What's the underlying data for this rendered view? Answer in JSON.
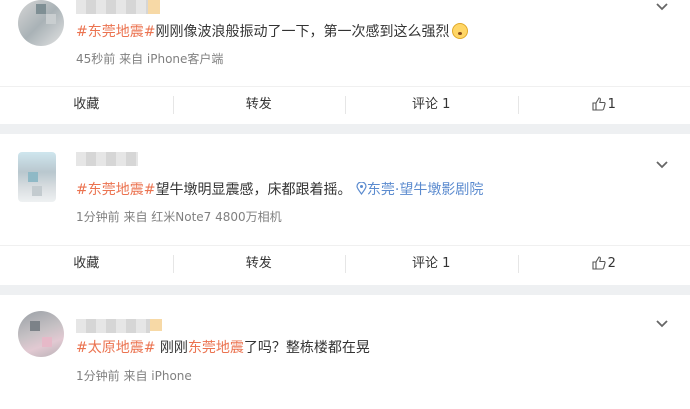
{
  "posts": [
    {
      "text_parts": [
        "#",
        "东莞地震",
        "#",
        "刚刚像波浪般振动了一下，第一次感到这么强烈"
      ],
      "meta": "45秒前  来自 iPhone客户端",
      "actions": {
        "collect": "收藏",
        "repost": "转发",
        "comment": "评论 1",
        "like": "1"
      },
      "emoji": "surprised-emoji"
    },
    {
      "text_parts": [
        "#",
        "东莞地震",
        "#",
        "望牛墩明显震感，床都跟着摇。",
        "东莞·望牛墩影剧院"
      ],
      "meta": "1分钟前  来自 红米Note7 4800万相机",
      "actions": {
        "collect": "收藏",
        "repost": "转发",
        "comment": "评论 1",
        "like": "2"
      },
      "location_icon": "location-pin-icon"
    },
    {
      "text_parts": [
        "#",
        "太原地震",
        "#",
        " 刚刚",
        "东莞地震",
        "了吗？整栋楼都在晃"
      ],
      "meta": "1分钟前  来自 iPhone"
    }
  ],
  "icons": {
    "menu": "chevron-down-icon",
    "like": "thumbs-up-icon"
  },
  "colors": {
    "topic": "#eb7350",
    "location": "#5b8bcf",
    "meta": "#808080",
    "background": "#eef0f2"
  }
}
